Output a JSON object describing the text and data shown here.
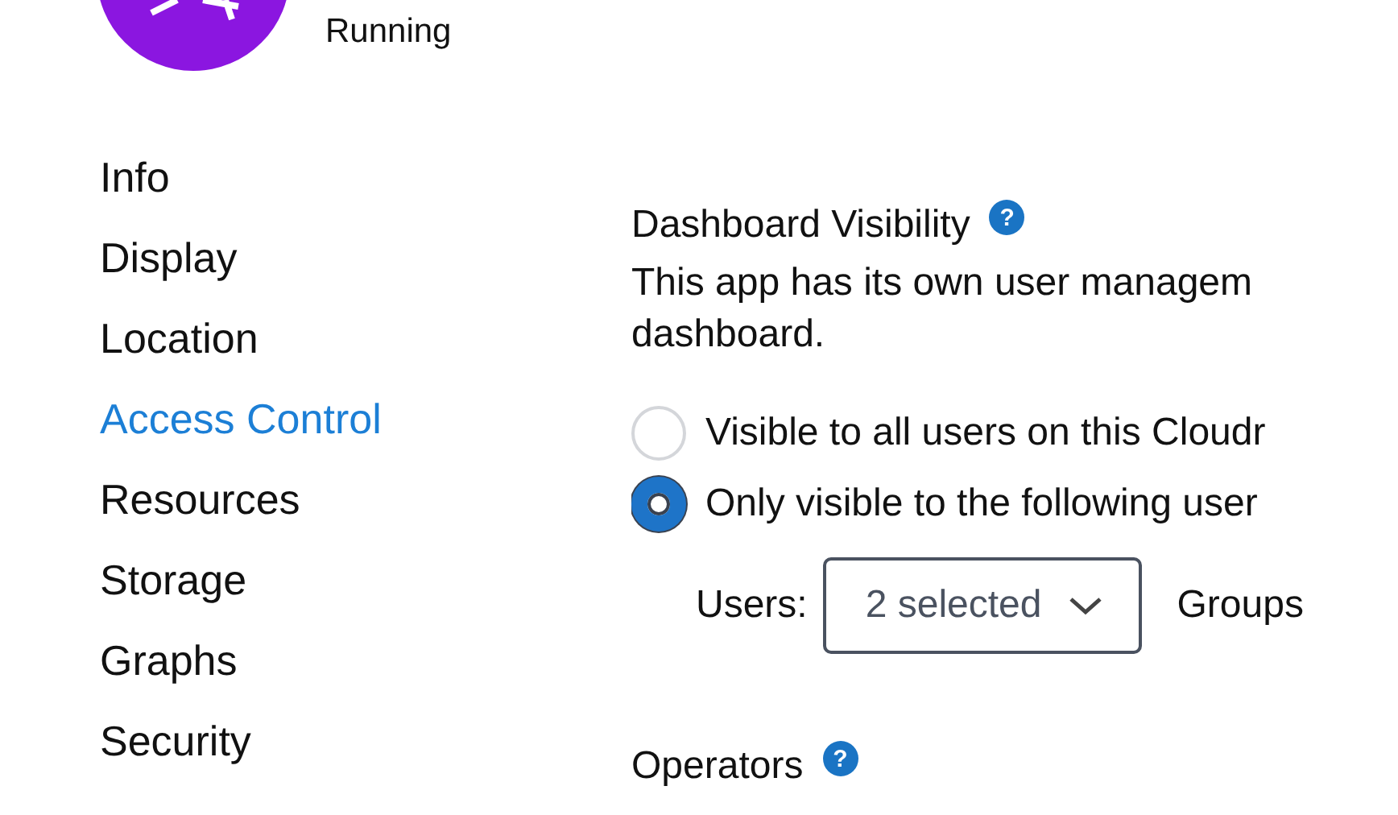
{
  "app": {
    "status": "Running"
  },
  "sidebar": {
    "items": [
      {
        "label": "Info",
        "selected": false
      },
      {
        "label": "Display",
        "selected": false
      },
      {
        "label": "Location",
        "selected": false
      },
      {
        "label": "Access Control",
        "selected": true
      },
      {
        "label": "Resources",
        "selected": false
      },
      {
        "label": "Storage",
        "selected": false
      },
      {
        "label": "Graphs",
        "selected": false
      },
      {
        "label": "Security",
        "selected": false
      }
    ]
  },
  "dashboard_visibility": {
    "title": "Dashboard Visibility",
    "help_icon": "?",
    "description_lines": [
      "This app has its own user managem",
      "dashboard."
    ],
    "options": [
      {
        "label": "Visible to all users on this Cloudr",
        "selected": false
      },
      {
        "label": "Only visible to the following user",
        "selected": true
      }
    ],
    "users_label": "Users:",
    "users_value": "2 selected",
    "groups_label": "Groups"
  },
  "operators": {
    "title": "Operators",
    "help_icon": "?"
  }
}
